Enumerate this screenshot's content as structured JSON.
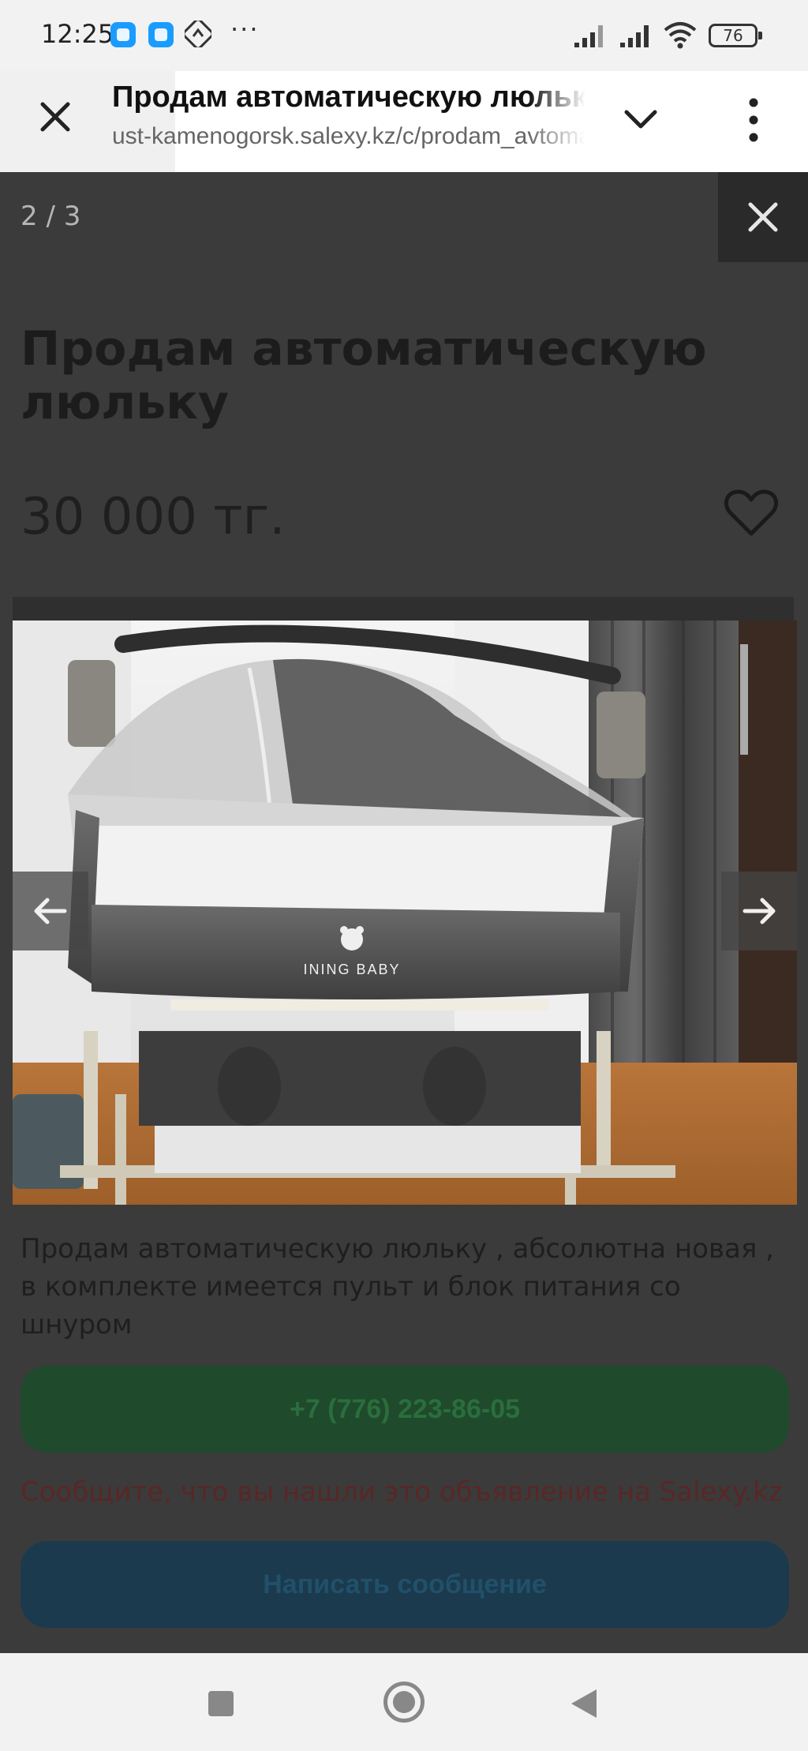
{
  "status_bar": {
    "time": "12:25",
    "battery": "76",
    "more": "···"
  },
  "browser": {
    "title": "Продам автоматическую люльку",
    "url": "ust-kamenogorsk.salexy.kz/c/prodam_avtomaticheskuyu"
  },
  "gallery": {
    "counter": "2 / 3",
    "logo_text": "INING BABY"
  },
  "listing": {
    "heading": "Продам автоматическую люльку",
    "price": "30 000 тг.",
    "description": "Продам автоматическую люльку , абсолютна новая , в комплекте имеется пульт и блок питания со шнуром",
    "phone": "+7 (776) 223-86-05",
    "notice": "Сообщите, что вы нашли это объявление на Salexy.kz",
    "message_label": "Написать сообщение"
  },
  "colors": {
    "phone_button": "#1f4a2c",
    "message_button": "#1b3a4e",
    "notice_text": "#5a2626"
  }
}
